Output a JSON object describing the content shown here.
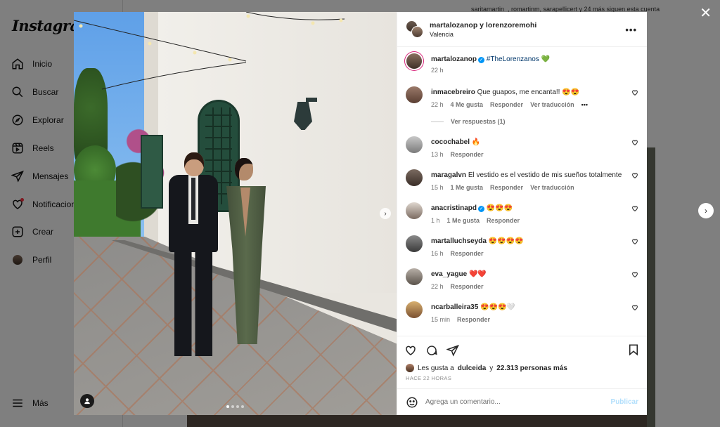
{
  "sidebar": {
    "logo": "Instagram",
    "items": [
      {
        "label": "Inicio",
        "icon": "home-icon"
      },
      {
        "label": "Buscar",
        "icon": "search-icon"
      },
      {
        "label": "Explorar",
        "icon": "compass-icon"
      },
      {
        "label": "Reels",
        "icon": "reels-icon"
      },
      {
        "label": "Mensajes",
        "icon": "send-icon"
      },
      {
        "label": "Notificaciones",
        "icon": "heart-icon"
      },
      {
        "label": "Crear",
        "icon": "plus-square-icon"
      },
      {
        "label": "Perfil",
        "icon": "profile-icon"
      }
    ],
    "more_label": "Más"
  },
  "background": {
    "follow_text": "saritamartin_, romartinm, sarapellicert y 24 más siguen esta cuenta"
  },
  "post": {
    "header": {
      "title": "martalozanop y lorenzoremohi",
      "location": "Valencia"
    },
    "caption": {
      "username": "martalozanop",
      "text": "#TheLorenzanos",
      "emoji": "💚",
      "time": "22 h"
    },
    "replies_label": "Ver respuestas (1)",
    "comments": [
      {
        "username": "inmacebreiro",
        "text": "Que guapos, me encanta!! 😍😍",
        "time": "22 h",
        "likes": "4 Me gusta",
        "reply": "Responder",
        "translate": "Ver traducción",
        "more": "•••",
        "verified": false
      },
      {
        "username": "cocochabel",
        "text": "🔥",
        "time": "13 h",
        "likes": "",
        "reply": "Responder",
        "translate": "",
        "verified": false
      },
      {
        "username": "maragalvn",
        "text": "El vestido es el vestido de mis sueños totalmente",
        "time": "15 h",
        "likes": "1 Me gusta",
        "reply": "Responder",
        "translate": "Ver traducción",
        "verified": false
      },
      {
        "username": "anacristinapd",
        "text": "😍😍😍",
        "time": "1 h",
        "likes": "1 Me gusta",
        "reply": "Responder",
        "translate": "",
        "verified": true
      },
      {
        "username": "martalluchseyda",
        "text": "😍😍😍😍",
        "time": "16 h",
        "likes": "",
        "reply": "Responder",
        "translate": "",
        "verified": false
      },
      {
        "username": "eva_yague",
        "text": "❤️❤️",
        "time": "22 h",
        "likes": "",
        "reply": "Responder",
        "translate": "",
        "verified": false
      },
      {
        "username": "ncarballeira35",
        "text": "😍😍😍🤍",
        "time": "15 min",
        "likes": "",
        "reply": "Responder",
        "translate": "",
        "verified": false
      }
    ],
    "likes": {
      "prefix": "Les gusta a",
      "user": "dulceida",
      "middle": "y",
      "count": "22.313 personas más"
    },
    "timeago": "HACE 22 HORAS",
    "comment_placeholder": "Agrega un comentario...",
    "publish_label": "Publicar"
  },
  "colors": {
    "accent_blue": "#0095f6",
    "publish_disabled": "#b2dffc",
    "story_ring": "#d8267b"
  }
}
